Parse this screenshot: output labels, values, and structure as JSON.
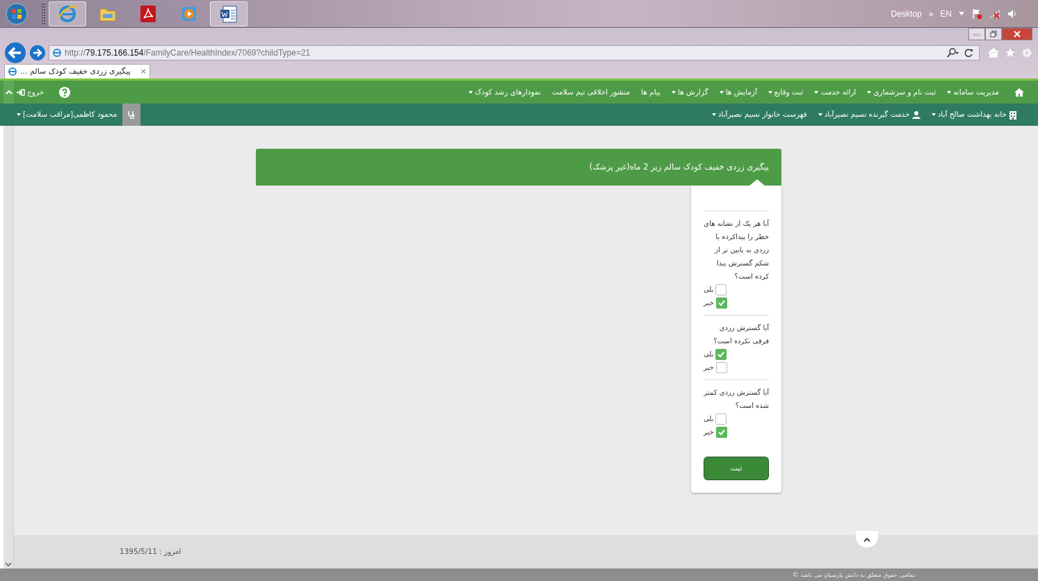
{
  "taskbar": {
    "apps": [
      {
        "kind": "browser",
        "running": true
      },
      {
        "kind": "folder",
        "running": false
      },
      {
        "kind": "pdf",
        "running": false
      },
      {
        "kind": "media",
        "running": false
      },
      {
        "kind": "word",
        "running": true
      }
    ],
    "toolbar_label": "Desktop",
    "toolbar_more": "»",
    "language": "EN"
  },
  "browser": {
    "address": {
      "scheme": "http://",
      "host": "79.175.166.154",
      "path": "/FamilyCare/HealthIndex/7069?childType=21"
    },
    "tab": {
      "title": "... پیگیری زردی خفیف کودک سالم",
      "close": "×"
    }
  },
  "main_nav": {
    "items": [
      {
        "label": "مدیریت سامانه",
        "dropdown": true
      },
      {
        "label": "ثبت نام و سرشماری",
        "dropdown": true
      },
      {
        "label": "ارائه خدمت",
        "dropdown": true
      },
      {
        "label": "ثبت وقایع",
        "dropdown": true
      },
      {
        "label": "آزمایش ها",
        "dropdown": true
      },
      {
        "label": "گزارش ها",
        "dropdown": true
      },
      {
        "label": "پیام ها",
        "dropdown": false
      },
      {
        "label": "منشور اخلاقی تیم سلامت",
        "dropdown": false
      },
      {
        "label": "نمودارهای رشد کودک",
        "dropdown": true
      }
    ],
    "logout": "خروج"
  },
  "sub_nav": {
    "items": [
      {
        "kind": "building",
        "label": "خانه بهداشت صالح آباد",
        "dropdown": true
      },
      {
        "kind": "user",
        "label": "خدمت گیرنده نسیم نصیرآباد",
        "dropdown": true
      },
      {
        "kind": "plain",
        "label": "فهرست خانوار نسیم نصیرآباد",
        "dropdown": true
      }
    ],
    "user": "محمود کاظمی[مراقب سلامت]"
  },
  "form": {
    "title": "پیگیری زردی خفیف کودک سالم زیر 2 ماه(غیر پزشک)",
    "questions": [
      {
        "text": "آیا هر یک از نشانه های خطر را پیداکرده یا زردی به پایین تر از شکم گسترش پیدا کرده است؟",
        "options": [
          {
            "label": "بلی",
            "checked": false
          },
          {
            "label": "خیر",
            "checked": true
          }
        ]
      },
      {
        "text": "آیا گسترش زردی فرقی نکرده است؟",
        "options": [
          {
            "label": "بلی",
            "checked": true
          },
          {
            "label": "خیر",
            "checked": false
          }
        ]
      },
      {
        "text": "آیا گسترش زردی کمتر شده است؟",
        "options": [
          {
            "label": "بلی",
            "checked": false
          },
          {
            "label": "خیر",
            "checked": true
          }
        ]
      }
    ],
    "submit": "ثبت"
  },
  "footer": {
    "date": "امروز : 1395/5/11",
    "copyright": "© تمامی حقوق متعلق به دانش پارسیان می باشد."
  }
}
